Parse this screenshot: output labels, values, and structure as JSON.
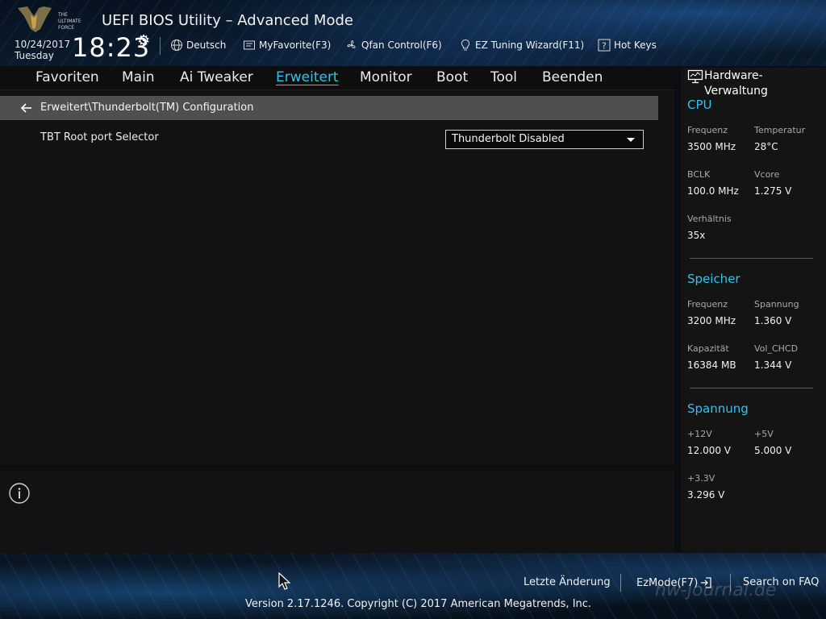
{
  "header": {
    "brand_line1": "THE",
    "brand_line2": "ULTIMATE",
    "brand_line3": "FORCE",
    "title": "UEFI BIOS Utility – Advanced Mode",
    "date": "10/24/2017",
    "day": "Tuesday",
    "time": "18:23",
    "tools": [
      {
        "label": "Deutsch",
        "icon": "globe-icon"
      },
      {
        "label": "MyFavorite(F3)",
        "icon": "favorite-card-icon"
      },
      {
        "label": "Qfan Control(F6)",
        "icon": "fan-icon"
      },
      {
        "label": "EZ Tuning Wizard(F11)",
        "icon": "lightbulb-icon"
      },
      {
        "label": "Hot Keys",
        "icon": "question-icon"
      }
    ]
  },
  "menu": {
    "items": [
      "Favoriten",
      "Main",
      "Ai Tweaker",
      "Erweitert",
      "Monitor",
      "Boot",
      "Tool",
      "Beenden"
    ],
    "active": "Erweitert"
  },
  "page": {
    "breadcrumb": "Erweitert\\Thunderbolt(TM) Configuration",
    "option_label": "TBT Root port Selector",
    "option_value": "Thunderbolt Disabled"
  },
  "hardware": {
    "title": "Hardware-Verwaltung",
    "cpu": {
      "heading": "CPU",
      "items": [
        {
          "label": "Frequenz",
          "value": "3500 MHz"
        },
        {
          "label": "Temperatur",
          "value": "28°C"
        },
        {
          "label": "BCLK",
          "value": "100.0 MHz"
        },
        {
          "label": "Vcore",
          "value": "1.275 V"
        },
        {
          "label": "Verhältnis",
          "value": "35x"
        }
      ]
    },
    "memory": {
      "heading": "Speicher",
      "items": [
        {
          "label": "Frequenz",
          "value": "3200 MHz"
        },
        {
          "label": "Spannung",
          "value": "1.360 V"
        },
        {
          "label": "Kapazität",
          "value": "16384 MB"
        },
        {
          "label": "Vol_CHCD",
          "value": "1.344 V"
        }
      ]
    },
    "voltage": {
      "heading": "Spannung",
      "items": [
        {
          "label": "+12V",
          "value": "12.000 V"
        },
        {
          "label": "+5V",
          "value": "5.000 V"
        },
        {
          "label": "+3.3V",
          "value": "3.296 V"
        }
      ]
    }
  },
  "footer": {
    "last_change": "Letzte Änderung",
    "ezmode": "EzMode(F7)",
    "faq": "Search on FAQ",
    "copyright": "Version 2.17.1246. Copyright (C) 2017 American Megatrends, Inc.",
    "watermark": "hw-journal.de"
  },
  "colors": {
    "accent": "#35c1ee",
    "background": "#121212",
    "breadcrumb_bar": "#4f4f4f"
  }
}
